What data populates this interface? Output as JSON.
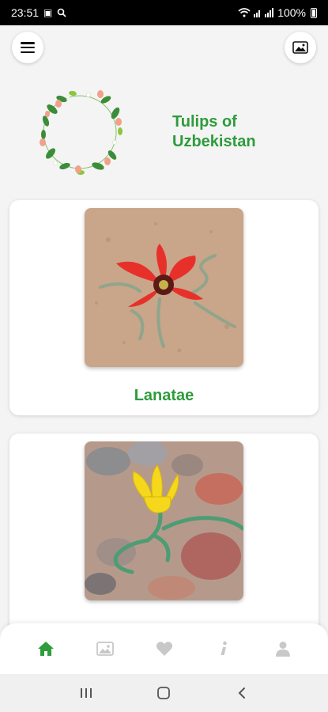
{
  "status": {
    "time": "23:51",
    "battery": "100%"
  },
  "header": {
    "title": "Tulips of Uzbekistan"
  },
  "cards": [
    {
      "label": "Lanatae",
      "flower_color": "#e8302a"
    },
    {
      "label": "",
      "flower_color": "#f5d81c"
    }
  ],
  "bottom_nav": {
    "items": [
      "home-icon",
      "gallery-icon",
      "heart-icon",
      "info-icon",
      "person-icon"
    ],
    "active": "home",
    "active_color": "#2e9b3c",
    "inactive_color": "#c8c8c8"
  },
  "colors": {
    "accent": "#2e9b3c"
  }
}
